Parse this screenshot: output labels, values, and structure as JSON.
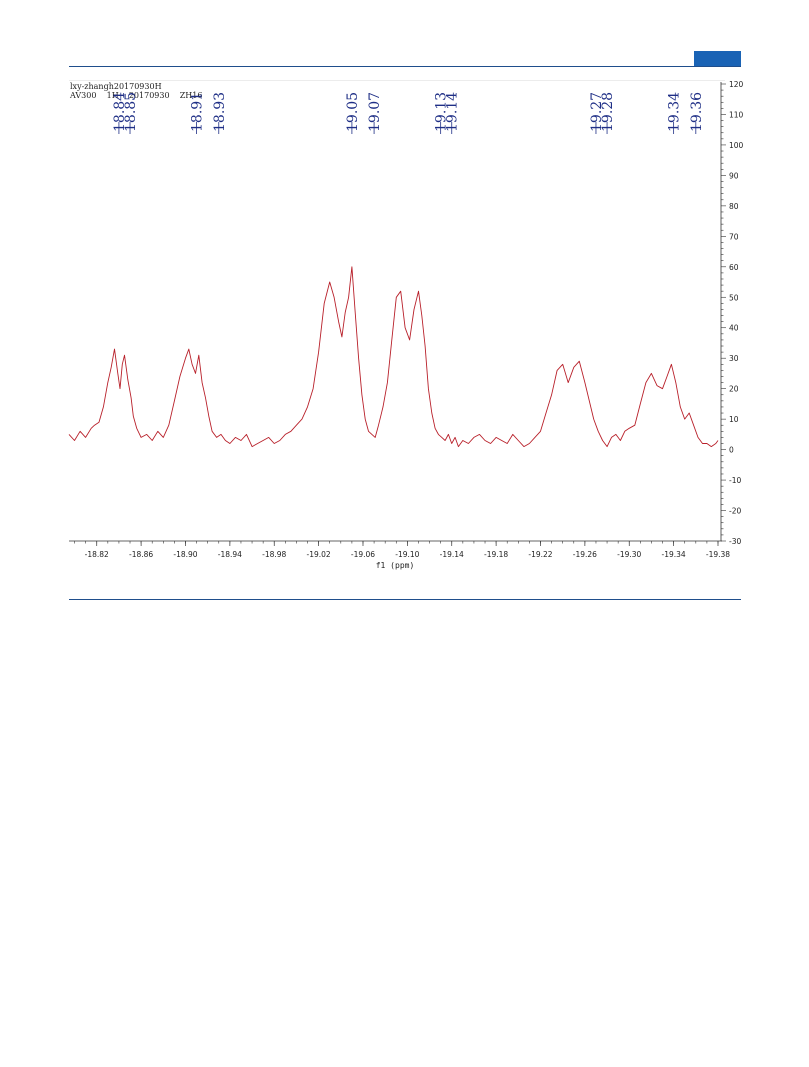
{
  "sample_info": {
    "line1": "lxy-zhangh20170930H",
    "line2": "AV300    1H    20170930    ZH16"
  },
  "chart_data": {
    "type": "line",
    "xlabel": "f1 (ppm)",
    "ylabel": "",
    "xlim": [
      -18.795,
      -19.38
    ],
    "ylim": [
      -30,
      120
    ],
    "x_ticks": [
      -18.82,
      -18.86,
      -18.9,
      -18.94,
      -18.98,
      -19.02,
      -19.06,
      -19.1,
      -19.14,
      -19.18,
      -19.22,
      -19.26,
      -19.3,
      -19.34,
      -19.38
    ],
    "x_tick_labels": [
      "-18.82",
      "-18.86",
      "-18.90",
      "-18.94",
      "-18.98",
      "-19.02",
      "-19.06",
      "-19.10",
      "-19.14",
      "-19.18",
      "-19.22",
      "-19.26",
      "-19.30",
      "-19.34",
      "-19.38"
    ],
    "y_ticks": [
      120,
      110,
      100,
      90,
      80,
      70,
      60,
      50,
      40,
      30,
      20,
      10,
      0,
      -10,
      -20,
      -30
    ],
    "y_tick_labels": [
      "120",
      "110",
      "100",
      "90",
      "80",
      "70",
      "60",
      "50",
      "40",
      "30",
      "20",
      "10",
      "0",
      "-10",
      "-20",
      "-30"
    ],
    "grid": false,
    "line_color": "#b8202a",
    "label_color": "#1f2f86",
    "peak_labels": [
      {
        "x": -18.84,
        "label": "18.84"
      },
      {
        "x": -18.85,
        "label": "18.85"
      },
      {
        "x": -18.91,
        "label": "18.91"
      },
      {
        "x": -18.93,
        "label": "18.93"
      },
      {
        "x": -19.05,
        "label": "19.05"
      },
      {
        "x": -19.07,
        "label": "19.07"
      },
      {
        "x": -19.13,
        "label": "19.13"
      },
      {
        "x": -19.14,
        "label": "19.14"
      },
      {
        "x": -19.27,
        "label": "19.27"
      },
      {
        "x": -19.28,
        "label": "19.28"
      },
      {
        "x": -19.34,
        "label": "19.34"
      },
      {
        "x": -19.36,
        "label": "19.36"
      }
    ],
    "series": [
      {
        "x": [
          -18.795,
          -18.8,
          -18.805,
          -18.81,
          -18.815,
          -18.818,
          -18.822,
          -18.826,
          -18.83,
          -18.833,
          -18.836,
          -18.839,
          -18.841,
          -18.843,
          -18.845,
          -18.848,
          -18.851,
          -18.853,
          -18.856,
          -18.86,
          -18.865,
          -18.87,
          -18.875,
          -18.88,
          -18.885,
          -18.89,
          -18.895,
          -18.9,
          -18.903,
          -18.906,
          -18.909,
          -18.912,
          -18.915,
          -18.918,
          -18.921,
          -18.924,
          -18.928,
          -18.932,
          -18.936,
          -18.94,
          -18.945,
          -18.95,
          -18.955,
          -18.96,
          -18.965,
          -18.97,
          -18.975,
          -18.98,
          -18.985,
          -18.99,
          -18.995,
          -19.0,
          -19.005,
          -19.01,
          -19.015,
          -19.02,
          -19.025,
          -19.03,
          -19.034,
          -19.038,
          -19.041,
          -19.044,
          -19.047,
          -19.05,
          -19.053,
          -19.056,
          -19.059,
          -19.062,
          -19.065,
          -19.068,
          -19.071,
          -19.074,
          -19.078,
          -19.082,
          -19.086,
          -19.09,
          -19.094,
          -19.098,
          -19.102,
          -19.106,
          -19.11,
          -19.113,
          -19.116,
          -19.119,
          -19.122,
          -19.125,
          -19.128,
          -19.131,
          -19.134,
          -19.137,
          -19.14,
          -19.143,
          -19.146,
          -19.15,
          -19.155,
          -19.16,
          -19.165,
          -19.17,
          -19.175,
          -19.18,
          -19.185,
          -19.19,
          -19.195,
          -19.2,
          -19.205,
          -19.21,
          -19.215,
          -19.22,
          -19.225,
          -19.23,
          -19.235,
          -19.24,
          -19.245,
          -19.25,
          -19.255,
          -19.26,
          -19.264,
          -19.268,
          -19.272,
          -19.276,
          -19.28,
          -19.284,
          -19.288,
          -19.292,
          -19.296,
          -19.3,
          -19.305,
          -19.31,
          -19.315,
          -19.32,
          -19.325,
          -19.33,
          -19.334,
          -19.338,
          -19.342,
          -19.346,
          -19.35,
          -19.354,
          -19.358,
          -19.362,
          -19.366,
          -19.37,
          -19.374,
          -19.378,
          -19.38
        ],
        "values": [
          5,
          3,
          6,
          4,
          7,
          8,
          9,
          14,
          22,
          27,
          33,
          25,
          20,
          28,
          31,
          23,
          17,
          11,
          7,
          4,
          5,
          3,
          6,
          4,
          8,
          16,
          24,
          30,
          33,
          28,
          25,
          31,
          22,
          17,
          11,
          6,
          4,
          5,
          3,
          2,
          4,
          3,
          5,
          1,
          2,
          3,
          4,
          2,
          3,
          5,
          6,
          8,
          10,
          14,
          20,
          32,
          48,
          55,
          50,
          42,
          37,
          45,
          50,
          60,
          45,
          30,
          18,
          10,
          6,
          5,
          4,
          8,
          14,
          22,
          36,
          50,
          52,
          40,
          36,
          46,
          52,
          44,
          34,
          20,
          12,
          7,
          5,
          4,
          3,
          5,
          2,
          4,
          1,
          3,
          2,
          4,
          5,
          3,
          2,
          4,
          3,
          2,
          5,
          3,
          1,
          2,
          4,
          6,
          12,
          18,
          26,
          28,
          22,
          27,
          29,
          22,
          16,
          10,
          6,
          3,
          1,
          4,
          5,
          3,
          6,
          7,
          8,
          15,
          22,
          25,
          21,
          20,
          24,
          28,
          22,
          14,
          10,
          12,
          8,
          4,
          2,
          2,
          1,
          2,
          3
        ]
      }
    ]
  }
}
